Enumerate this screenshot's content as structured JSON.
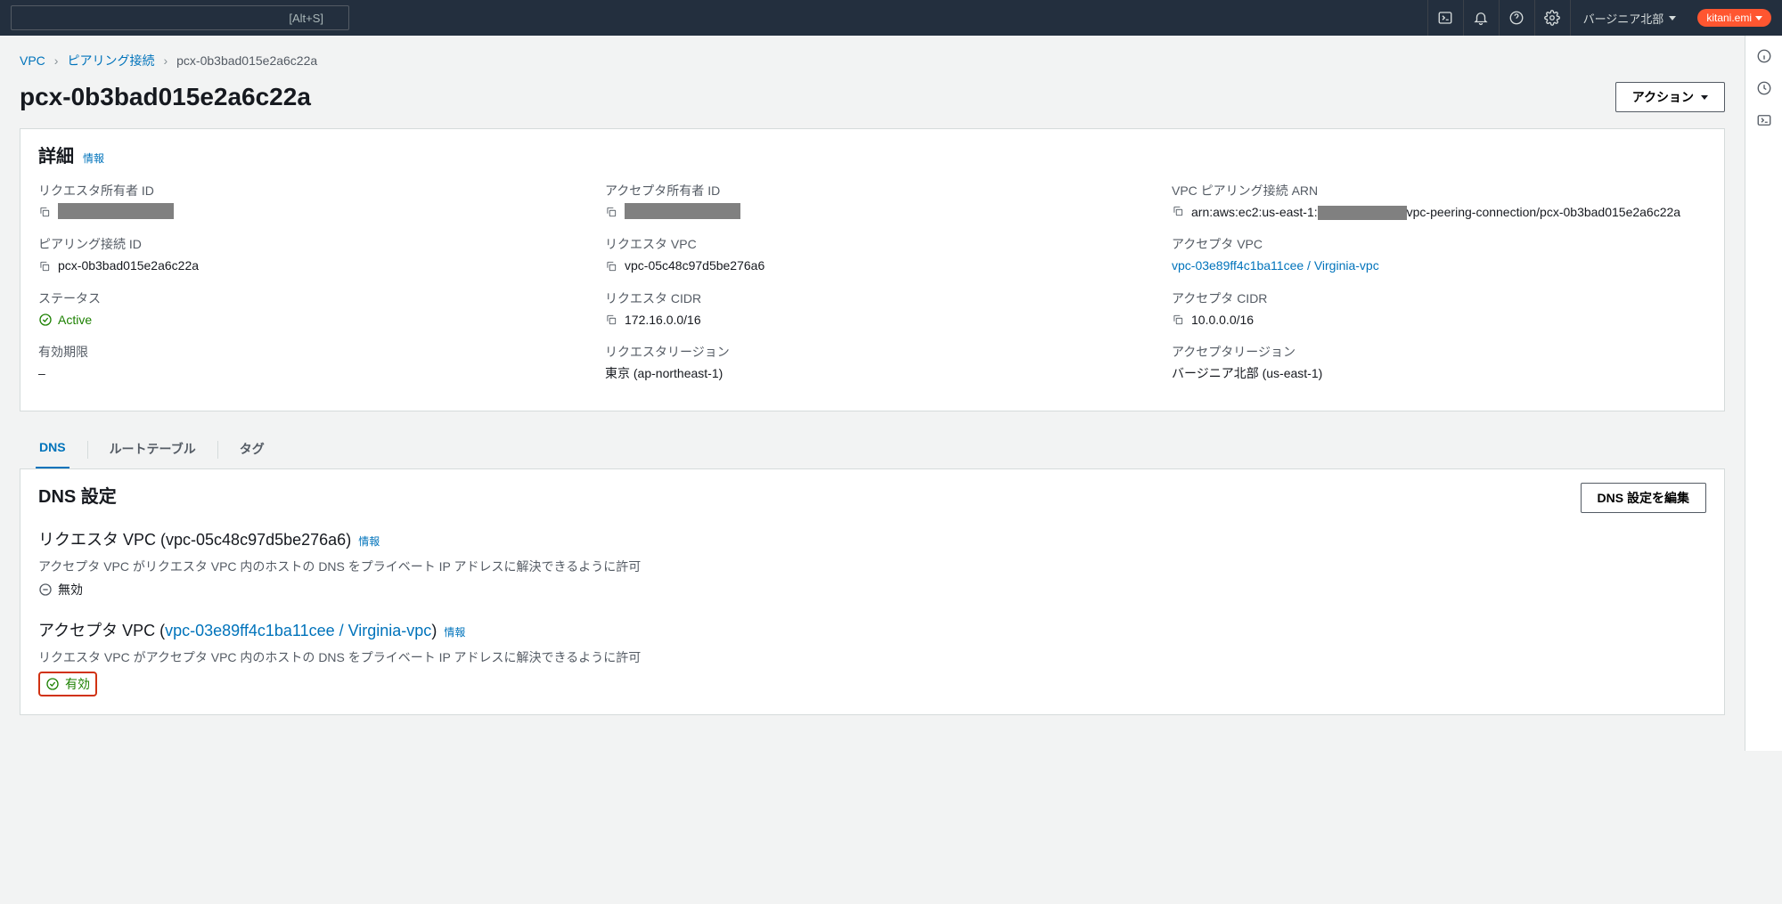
{
  "topbar": {
    "search_hint": "[Alt+S]",
    "region": "バージニア北部",
    "user": "kitani.emi"
  },
  "breadcrumb": {
    "root": "VPC",
    "parent": "ピアリング接続",
    "current": "pcx-0b3bad015e2a6c22a"
  },
  "page_title": "pcx-0b3bad015e2a6c22a",
  "actions_button": "アクション",
  "details_panel": {
    "title": "詳細",
    "info": "情報",
    "requester_owner_label": "リクエスタ所有者 ID",
    "accepter_owner_label": "アクセプタ所有者 ID",
    "arn_label": "VPC ピアリング接続 ARN",
    "arn_prefix": "arn:aws:ec2:us-east-1:",
    "arn_suffix": "vpc-peering-connection/pcx-0b3bad015e2a6c22a",
    "peering_id_label": "ピアリング接続 ID",
    "peering_id": "pcx-0b3bad015e2a6c22a",
    "requester_vpc_label": "リクエスタ VPC",
    "requester_vpc": "vpc-05c48c97d5be276a6",
    "accepter_vpc_label": "アクセプタ VPC",
    "accepter_vpc": "vpc-03e89ff4c1ba11cee / Virginia-vpc",
    "status_label": "ステータス",
    "status": "Active",
    "requester_cidr_label": "リクエスタ CIDR",
    "requester_cidr": "172.16.0.0/16",
    "accepter_cidr_label": "アクセプタ CIDR",
    "accepter_cidr": "10.0.0.0/16",
    "expiration_label": "有効期限",
    "expiration": "–",
    "requester_region_label": "リクエスタリージョン",
    "requester_region": "東京 (ap-northeast-1)",
    "accepter_region_label": "アクセプタリージョン",
    "accepter_region": "バージニア北部 (us-east-1)"
  },
  "tabs": {
    "dns": "DNS",
    "route_tables": "ルートテーブル",
    "tags": "タグ"
  },
  "dns_panel": {
    "title": "DNS 設定",
    "edit_button": "DNS 設定を編集",
    "info": "情報",
    "requester_title_prefix": "リクエスタ VPC (",
    "requester_vpc": "vpc-05c48c97d5be276a6",
    "requester_title_suffix": ")",
    "requester_desc": "アクセプタ VPC がリクエスタ VPC 内のホストの DNS をプライベート IP アドレスに解決できるように許可",
    "requester_status": "無効",
    "accepter_title_prefix": "アクセプタ VPC (",
    "accepter_vpc": "vpc-03e89ff4c1ba11cee / Virginia-vpc",
    "accepter_title_suffix": ")",
    "accepter_desc": "リクエスタ VPC がアクセプタ VPC 内のホストの DNS をプライベート IP アドレスに解決できるように許可",
    "accepter_status": "有効"
  }
}
